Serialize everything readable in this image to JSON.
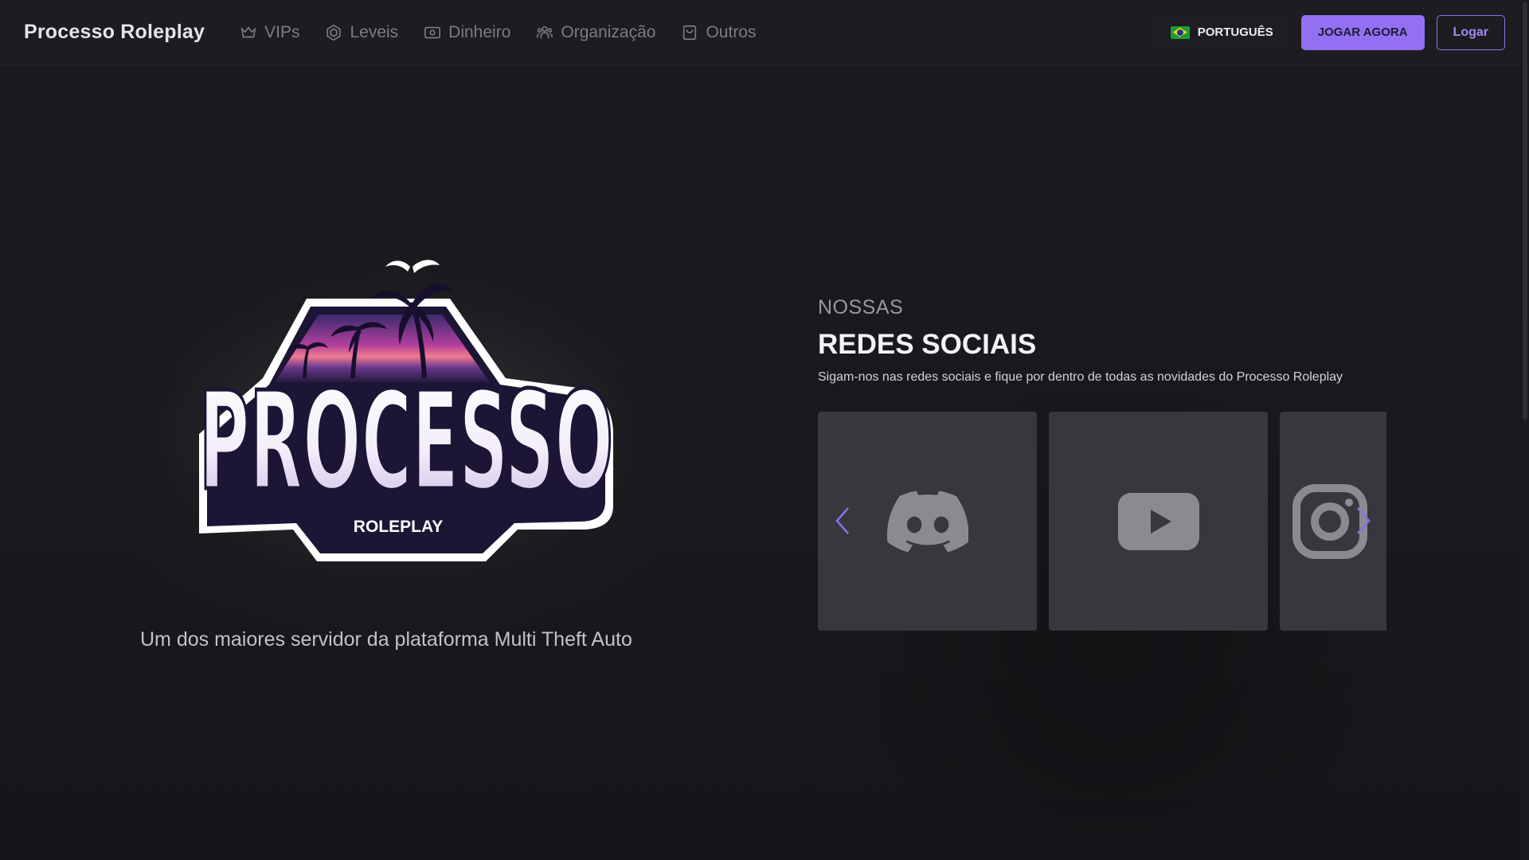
{
  "navbar": {
    "brand": "Processo Roleplay",
    "links": [
      {
        "label": "VIPs",
        "icon": "crown-icon"
      },
      {
        "label": "Leveis",
        "icon": "hexagon-icon"
      },
      {
        "label": "Dinheiro",
        "icon": "banknote-icon"
      },
      {
        "label": "Organização",
        "icon": "users-icon"
      },
      {
        "label": "Outros",
        "icon": "shopping-bag-icon"
      }
    ],
    "language": {
      "label": "PORTUGUÊS",
      "flag": "brazil-flag-icon"
    },
    "play_button": "JOGAR AGORA",
    "login_button": "Logar"
  },
  "hero": {
    "logo_text": "PROCESSO",
    "logo_subtext": "ROLEPLAY",
    "tagline": "Um dos maiores servidor da plataforma Multi Theft Auto"
  },
  "social": {
    "eyebrow": "NOSSAS",
    "title": "REDES SOCIAIS",
    "description": "Sigam-nos nas redes sociais e fique por dentro de todas as novidades do Processo Roleplay",
    "cards": [
      {
        "icon": "discord-icon"
      },
      {
        "icon": "youtube-icon"
      },
      {
        "icon": "instagram-icon"
      }
    ]
  },
  "colors": {
    "accent": "#9370f2",
    "background": "#19181c",
    "card": "#38373c"
  }
}
